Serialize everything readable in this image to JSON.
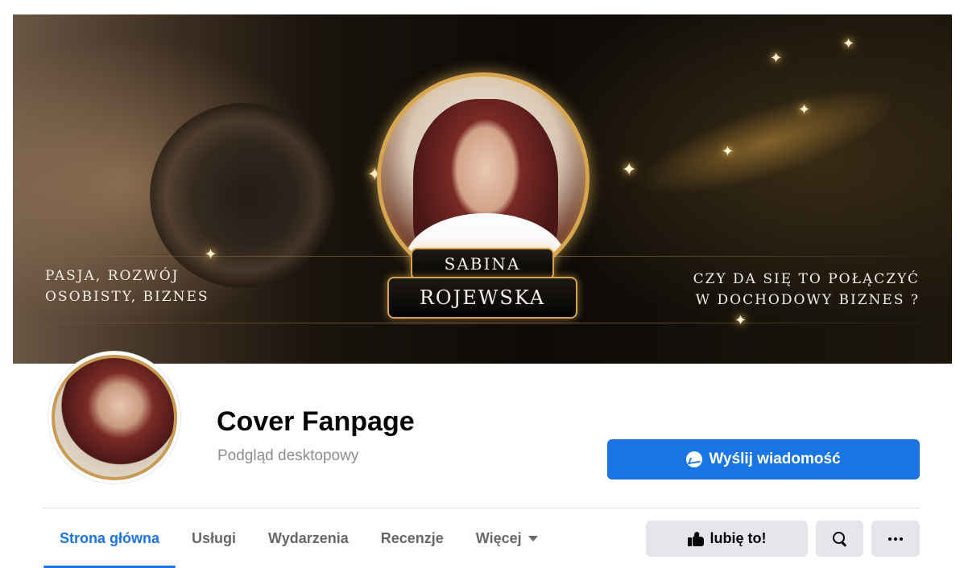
{
  "cover": {
    "name_first": "SABINA",
    "name_last": "ROJEWSKA",
    "tagline_left_line1": "PASJA, ROZWÓJ",
    "tagline_left_line2": "OSOBISTY, BIZNES",
    "tagline_right_line1": "CZY DA SIĘ TO POŁĄCZYĆ",
    "tagline_right_line2": "W DOCHODOWY BIZNES ?",
    "accent_gold": "#d4a350"
  },
  "profile": {
    "title": "Cover Fanpage",
    "subtitle": "Podgląd desktopowy"
  },
  "actions": {
    "message_label": "Wyślij wiadomość",
    "message_icon": "messenger-icon",
    "like_label": "lubię to!",
    "like_icon": "thumbs-up-icon",
    "search_icon": "search-icon",
    "more_icon": "more-dots-icon",
    "accent_blue": "#1b74e4"
  },
  "tabs": {
    "items": [
      {
        "label": "Strona główna",
        "active": true
      },
      {
        "label": "Usługi",
        "active": false
      },
      {
        "label": "Wydarzenia",
        "active": false
      },
      {
        "label": "Recenzje",
        "active": false
      },
      {
        "label": "Więcej",
        "active": false,
        "has_caret": true
      }
    ]
  }
}
